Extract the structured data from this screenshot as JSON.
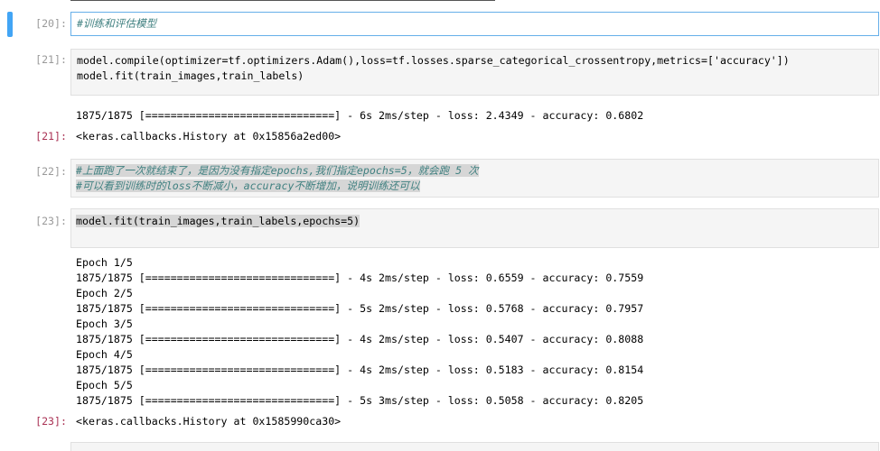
{
  "cells": [
    {
      "prompt": "[20]:",
      "text": "#训练和评估模型"
    },
    {
      "prompt": "[21]:",
      "lines": [
        "model.compile(optimizer=tf.optimizers.Adam(),loss=tf.losses.sparse_categorical_crossentropy,metrics=['accuracy'])",
        "model.fit(train_images,train_labels)"
      ],
      "stream": [
        "1875/1875 [==============================] - 6s 2ms/step - loss: 2.4349 - accuracy: 0.6802"
      ],
      "result": "<keras.callbacks.History at 0x15856a2ed00>"
    },
    {
      "prompt": "[22]:",
      "lines": [
        "#上面跑了一次就结束了，是因为没有指定epochs,我们指定epochs=5，就会跑 5 次",
        "#可以看到训练时的loss不断减小，accuracy不断增加，说明训练还可以"
      ]
    },
    {
      "prompt": "[23]:",
      "lines": [
        "model.fit(train_images,train_labels,epochs=5)"
      ],
      "stream": [
        "Epoch 1/5",
        "1875/1875 [==============================] - 4s 2ms/step - loss: 0.6559 - accuracy: 0.7559",
        "Epoch 2/5",
        "1875/1875 [==============================] - 5s 2ms/step - loss: 0.5768 - accuracy: 0.7957",
        "Epoch 3/5",
        "1875/1875 [==============================] - 4s 2ms/step - loss: 0.5407 - accuracy: 0.8088",
        "Epoch 4/5",
        "1875/1875 [==============================] - 4s 2ms/step - loss: 0.5183 - accuracy: 0.8154",
        "Epoch 5/5",
        "1875/1875 [==============================] - 5s 3ms/step - loss: 0.5058 - accuracy: 0.8205"
      ],
      "result": "<keras.callbacks.History at 0x1585990ca30>"
    }
  ],
  "colors": {
    "selected_cell_border": "#66afe9",
    "selection_bar": "#42a5f5",
    "comment": "#408080"
  }
}
